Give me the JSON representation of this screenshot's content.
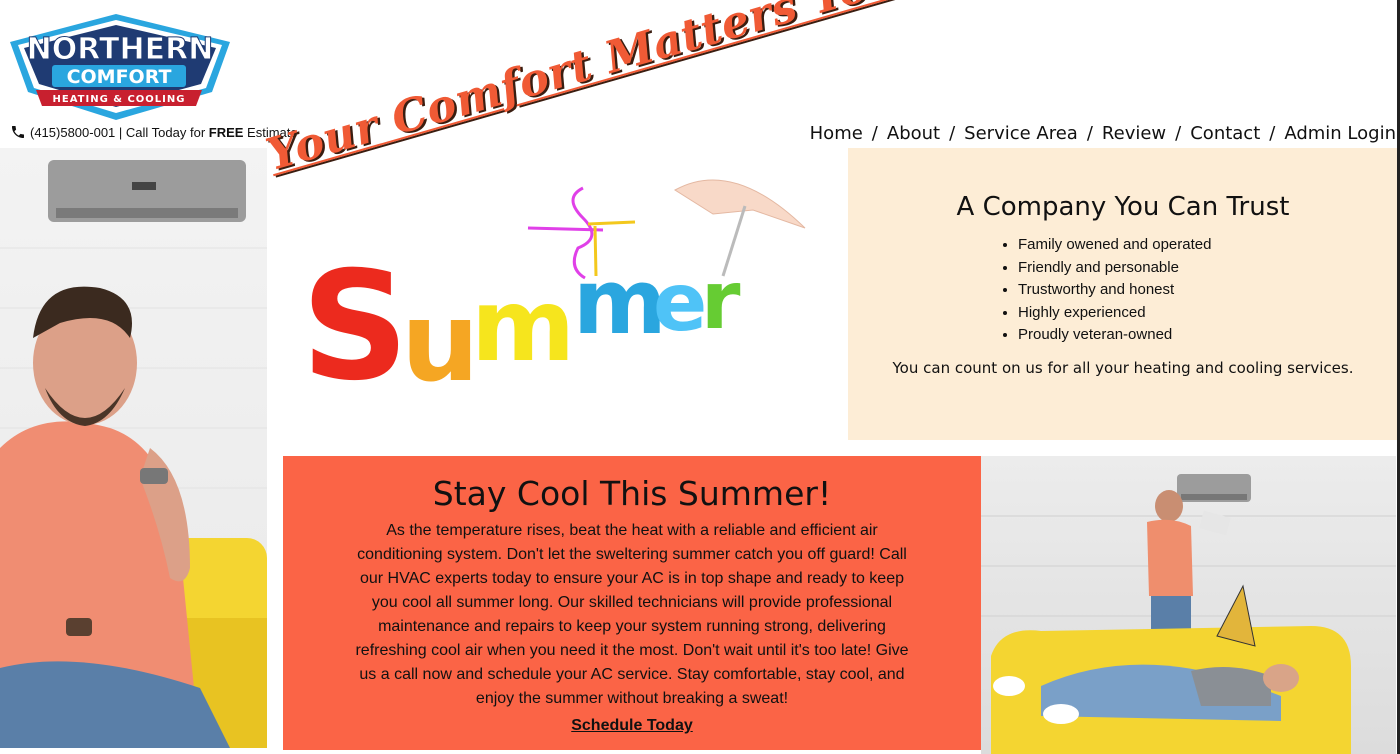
{
  "brand": {
    "name_line1": "NORTHERN",
    "name_line2": "COMFORT",
    "tagline": "HEATING & COOLING",
    "colors": {
      "navy": "#1f3b73",
      "red": "#c8202f",
      "sky": "#2aa6df",
      "accent": "#f05a35"
    }
  },
  "header": {
    "phone_icon": "phone-icon",
    "phone": "(415)5800-001",
    "call_pre": " | Call Today for ",
    "call_bold": "FREE",
    "call_post": " Estimate",
    "slogan": "Your Comfort Matters To Us!!"
  },
  "nav": {
    "items": [
      {
        "label": "Home"
      },
      {
        "label": "About"
      },
      {
        "label": "Service Area"
      },
      {
        "label": "Review"
      },
      {
        "label": "Contact"
      },
      {
        "label": "Admin Login"
      }
    ],
    "separator": "/"
  },
  "summer_graphic": {
    "word": "Summer"
  },
  "trust": {
    "title": "A Company You Can Trust",
    "bullets": [
      "Family owened and operated",
      "Friendly and personable",
      "Trustworthy and honest",
      "Highly experienced",
      "Proudly veteran-owned"
    ],
    "note": "You can count on us for all your heating and cooling services.",
    "background": "#fdedd6"
  },
  "promo": {
    "title": "Stay Cool This Summer!",
    "body": "As the temperature rises, beat the heat with a reliable and efficient air conditioning system. Don't let the sweltering summer catch you off guard! Call our HVAC experts today to ensure your AC is in top shape and ready to keep you cool all summer long. Our skilled technicians will provide professional maintenance and repairs to keep your system running strong, delivering refreshing cool air when you need it the most. Don't wait until it's too late! Give us a call now and schedule your AC service. Stay comfortable, stay cool, and enjoy the summer without breaking a sweat!",
    "cta": "Schedule Today",
    "background": "#fb6446"
  }
}
